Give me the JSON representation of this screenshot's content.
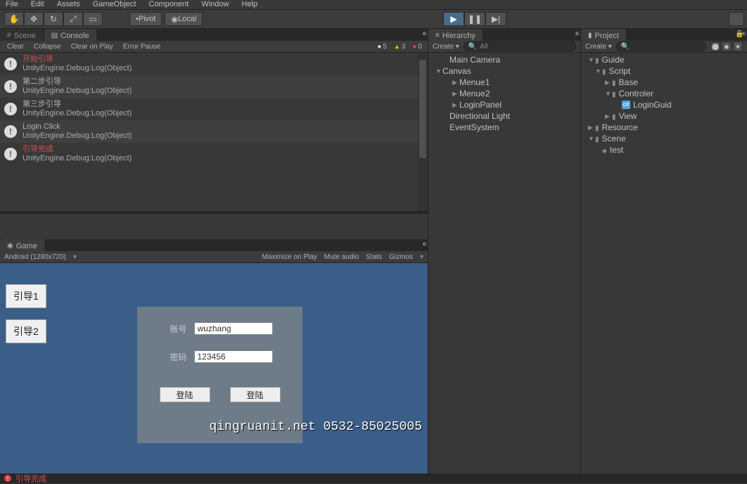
{
  "menu": {
    "file": "File",
    "edit": "Edit",
    "assets": "Assets",
    "gameobject": "GameObject",
    "component": "Component",
    "window": "Window",
    "help": "Help"
  },
  "toolbar": {
    "pivot": "Pivot",
    "local": "Local"
  },
  "tabs": {
    "scene": "Scene",
    "console": "Console",
    "game": "Game",
    "hierarchy": "Hierarchy",
    "project": "Project"
  },
  "console_tb": {
    "clear": "Clear",
    "collapse": "Collapse",
    "clear_on_play": "Clear on Play",
    "error_pause": "Error Pause",
    "info_count": "5",
    "warn_count": "3",
    "err_count": "0"
  },
  "console_items": [
    {
      "l1": "开始引导",
      "red": true,
      "l2": "UnityEngine.Debug:Log(Object)"
    },
    {
      "l1": "第二步引导",
      "red": false,
      "l2": "UnityEngine.Debug:Log(Object)"
    },
    {
      "l1": "第三步引导",
      "red": false,
      "l2": "UnityEngine.Debug:Log(Object)"
    },
    {
      "l1": "Login Click",
      "red": false,
      "l2": "UnityEngine.Debug:Log(Object)"
    },
    {
      "l1": "引导完成",
      "red": true,
      "l2": "UnityEngine.Debug:Log(Object)"
    }
  ],
  "game_tb": {
    "platform": "Android (1280x720)",
    "maximize": "Maximize on Play",
    "mute": "Mute audio",
    "stats": "Stats",
    "gizmos": "Gizmos"
  },
  "game": {
    "btn1": "引导1",
    "btn2": "引导2",
    "user_label": "账号",
    "user_val": "wuzhang",
    "pass_label": "密码",
    "pass_val": "123456",
    "login_btn": "登陆",
    "watermark": "qingruanit.net 0532-85025005"
  },
  "hierarchy": {
    "create": "Create",
    "search_ph": "All",
    "items": [
      "Main Camera",
      "Canvas",
      "Menue1",
      "Menue2",
      "LoginPanel",
      "Directional Light",
      "EventSystem"
    ]
  },
  "project": {
    "create": "Create",
    "tree": {
      "guide": "Guide",
      "script": "Script",
      "base": "Base",
      "controler": "Controler",
      "loginguid": "LoginGuid",
      "view": "View",
      "resource": "Resource",
      "scene": "Scene",
      "test": "test"
    }
  },
  "bottom": {
    "msg": "引导完成"
  }
}
